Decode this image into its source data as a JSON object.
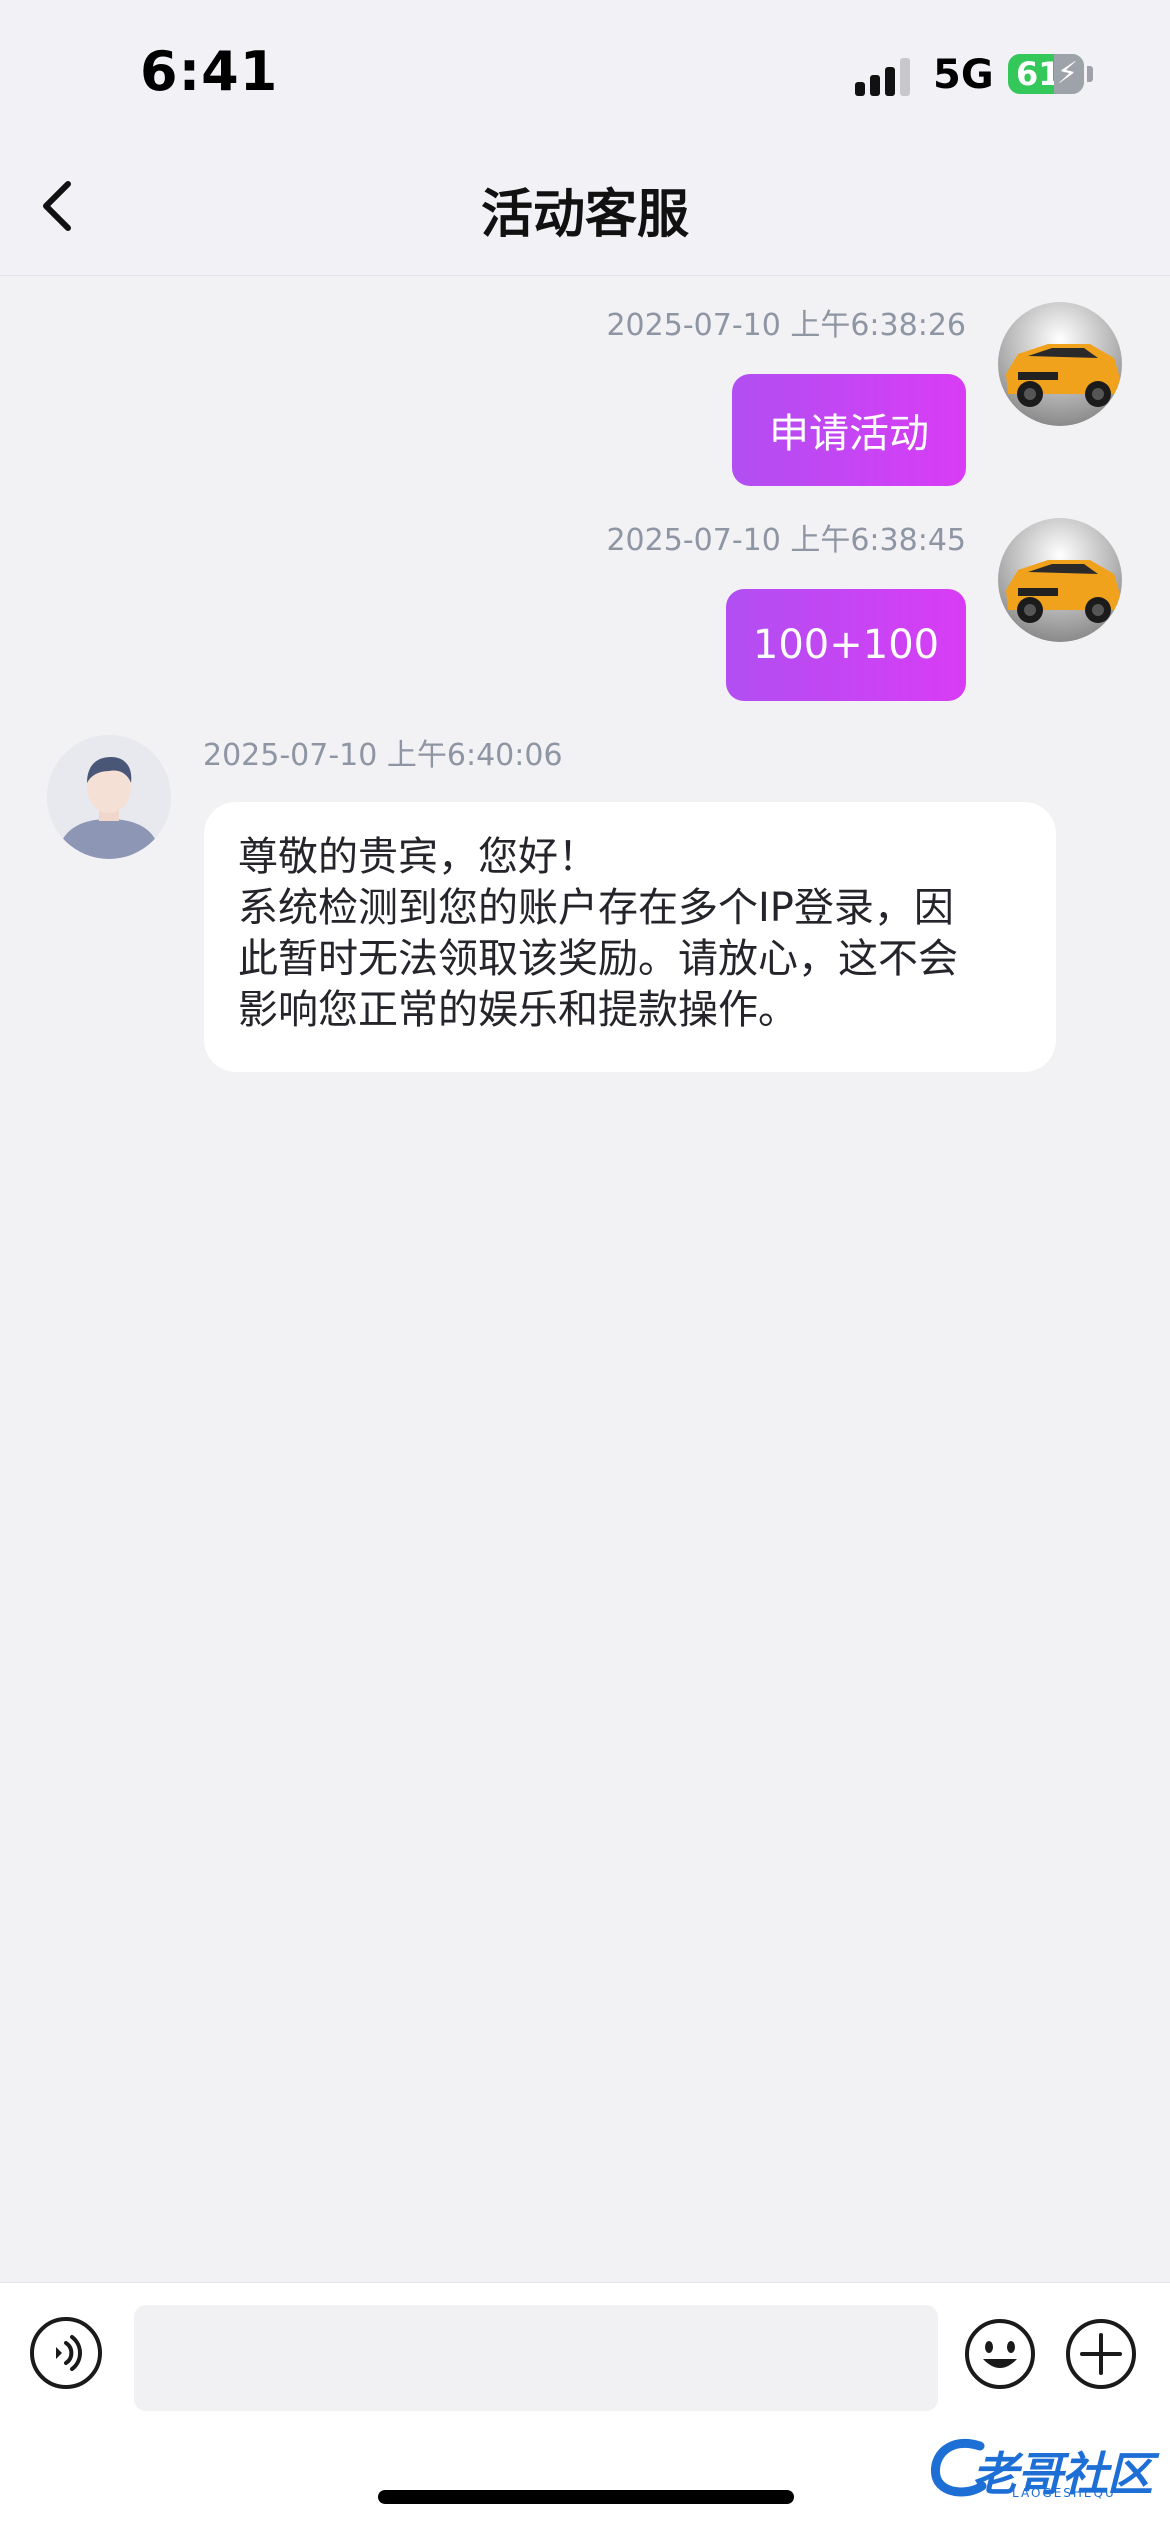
{
  "status_bar": {
    "time": "6:41",
    "network": "5G",
    "battery": "61"
  },
  "nav": {
    "title": "活动客服"
  },
  "messages": [
    {
      "side": "out",
      "timestamp": "2025-07-10 上午6:38:26",
      "text": "申请活动"
    },
    {
      "side": "out",
      "timestamp": "2025-07-10 上午6:38:45",
      "text": "100+100"
    },
    {
      "side": "in",
      "timestamp": "2025-07-10 上午6:40:06",
      "lines": [
        "尊敬的贵宾，您好！",
        "系统检测到您的账户存在多个IP登录，因",
        "此暂时无法领取该奖励。请放心，这不会",
        "影响您正常的娱乐和提款操作。"
      ]
    }
  ],
  "input": {
    "placeholder": ""
  },
  "watermark": {
    "text": "老哥社区",
    "sub": "LAOGESHEQU"
  },
  "colors": {
    "bubble_out_start": "#b14ff2",
    "bubble_out_end": "#d83cf5",
    "background": "#f2f2f5",
    "battery": "#34c759"
  }
}
